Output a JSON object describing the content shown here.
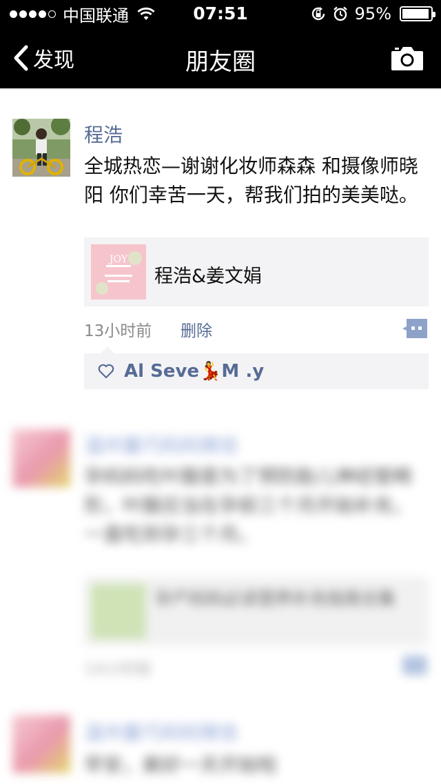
{
  "status_bar": {
    "carrier": "中国联通",
    "time": "07:51",
    "battery": "95%",
    "battery_level": 0.95,
    "signal_bars_filled": 4,
    "signal_bars_total": 5
  },
  "nav": {
    "back_label": "发现",
    "title": "朋友圈",
    "camera_icon": "camera-icon",
    "back_icon": "chevron-left-icon"
  },
  "post": {
    "author": "程浩",
    "text": "全城热恋—谢谢化妆师森森 和摄像师晓阳 你们幸苦一天，帮我们拍的美美哒。",
    "share": {
      "title": "程浩&姜文娟",
      "thumb_text": "JOY"
    },
    "time_ago": "13小时前",
    "delete_label": "删除",
    "likes": "Al Seve💃M .y"
  },
  "blurred": {
    "post1": {
      "author": "温州量巧妈妈微信",
      "text": "孕妈妈吃叶酸是为了预防胎儿神经管畸形，叶酸应当在孕前三个月开始补充，一直吃到孕三个月。",
      "share_title": "孕产妈妈必读营养补充指南合集",
      "time_ago": "14小时前"
    },
    "post2": {
      "author": "温州量巧妈妈微信",
      "text": "早安，美好一天开始啦"
    }
  },
  "colors": {
    "link": "#576b95",
    "bar": "#000000",
    "card_bg": "#f3f3f5"
  }
}
